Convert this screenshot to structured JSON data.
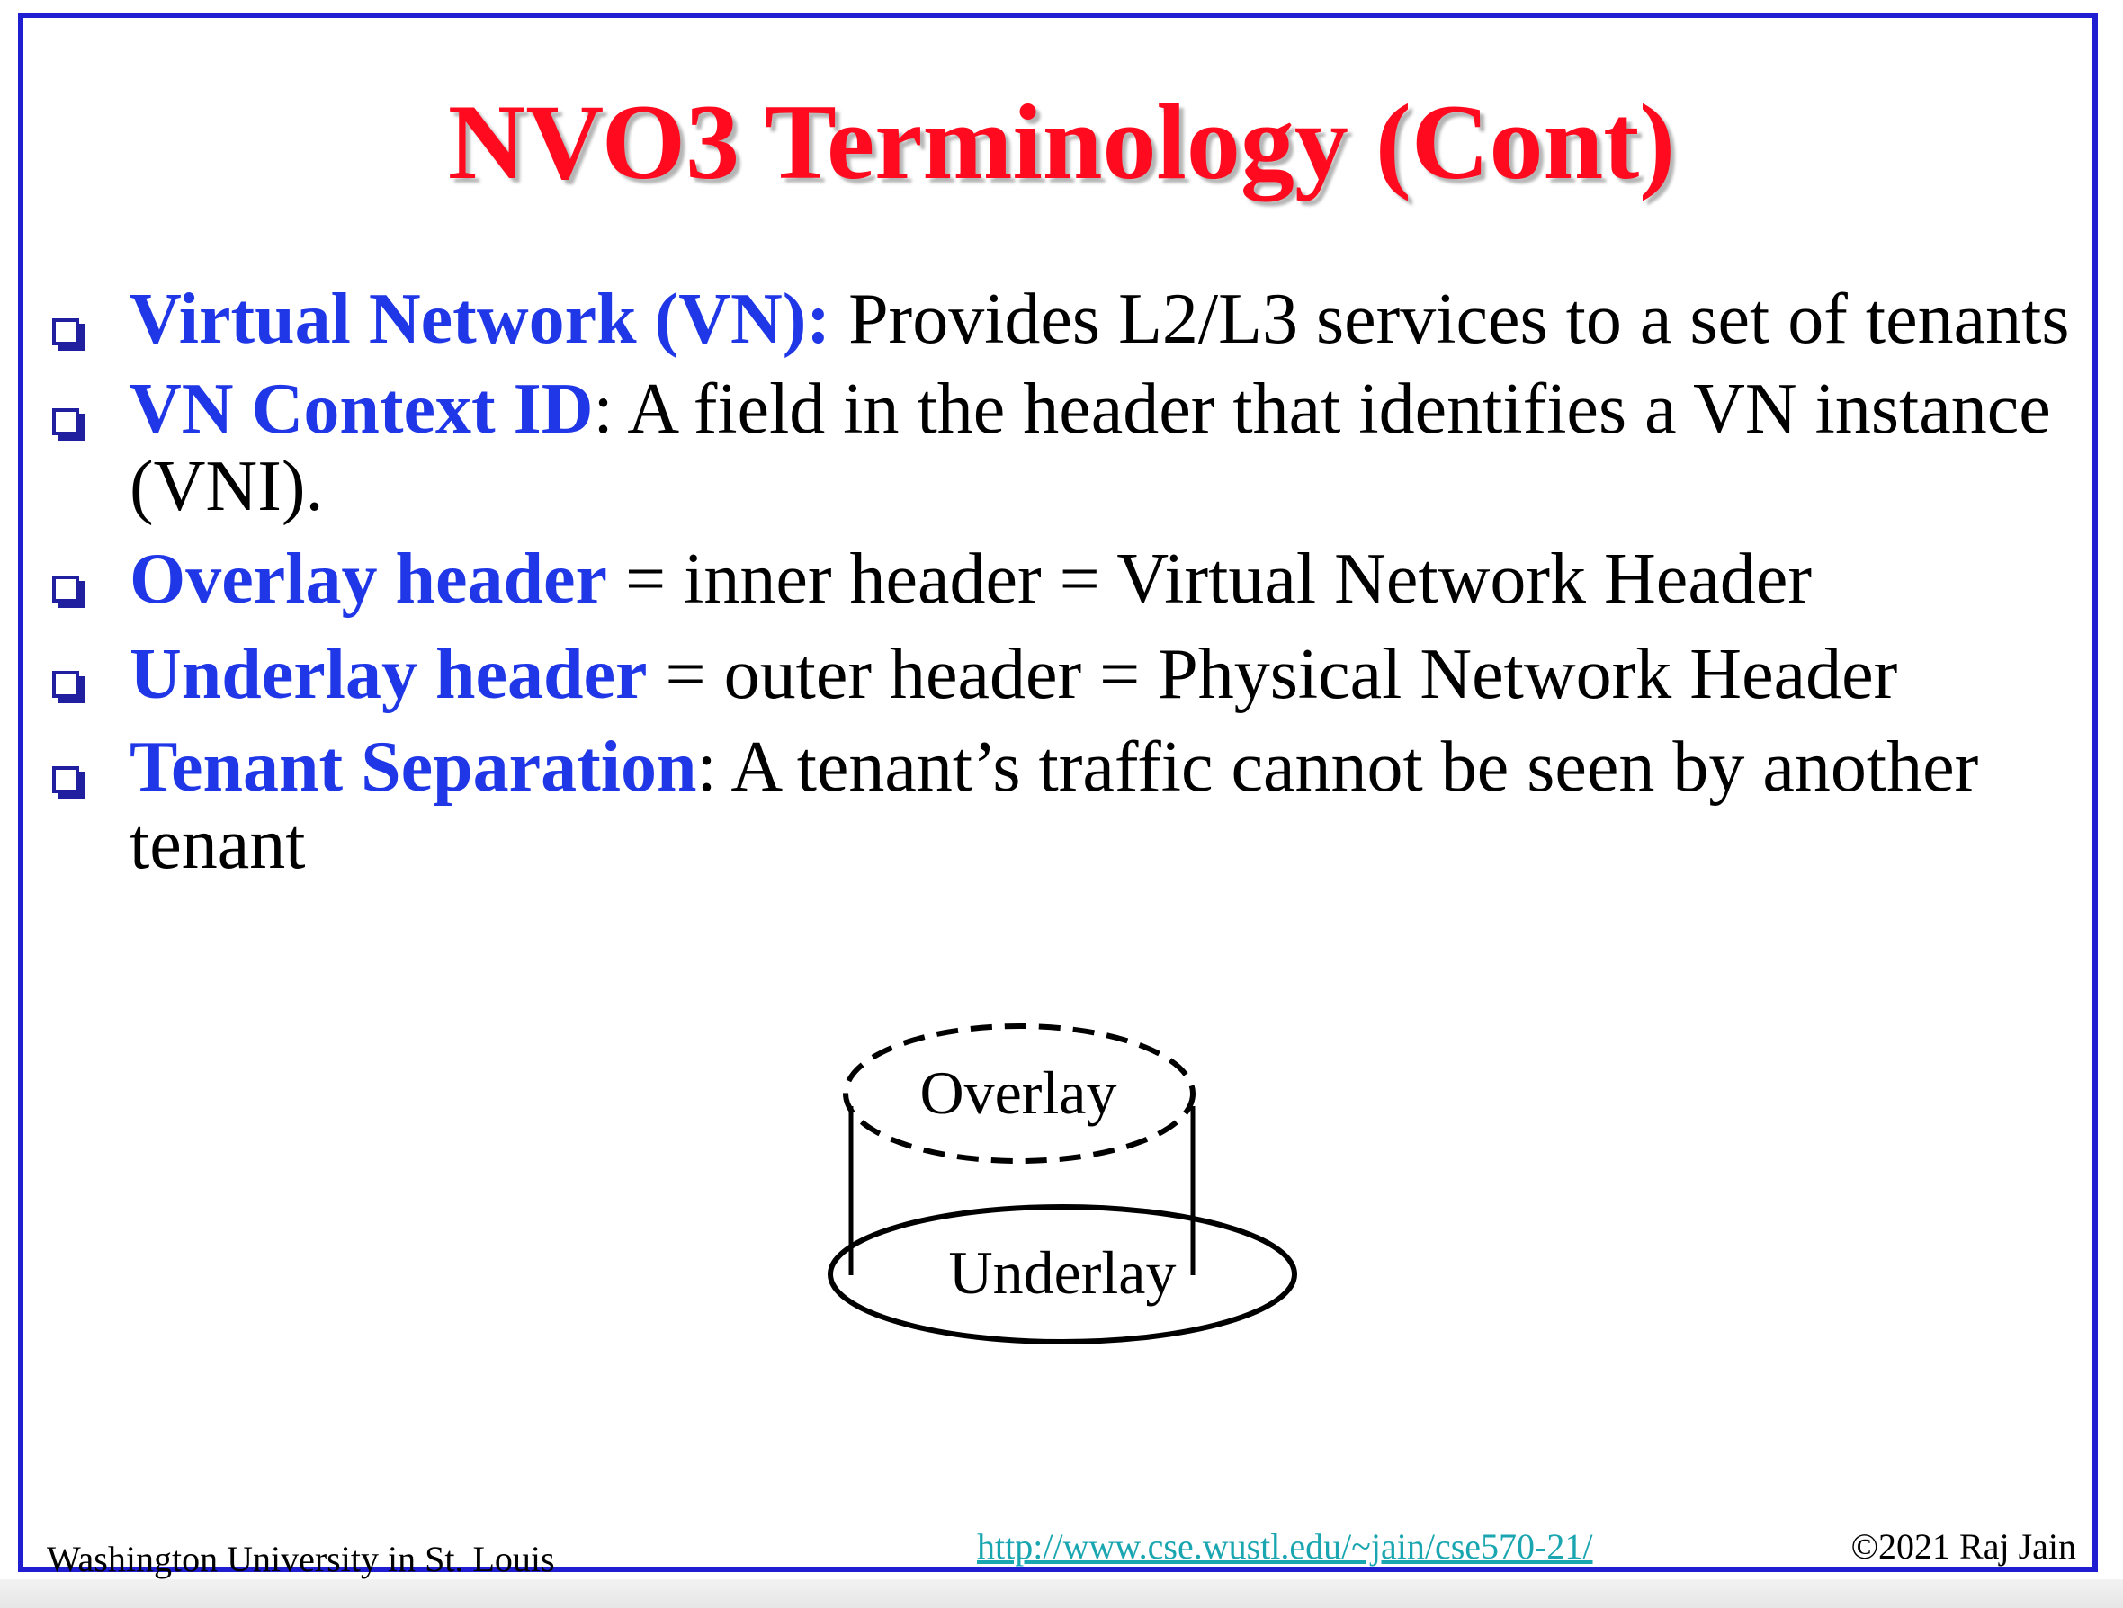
{
  "slide": {
    "title": "NVO3 Terminology (Cont)",
    "bullets": [
      {
        "term": "Virtual Network (VN):",
        "text": " Provides L2/L3 services to a set of tenants"
      },
      {
        "term": "VN Context ID",
        "text": ": A field in the header that identifies a VN instance (VNI)."
      },
      {
        "term": "Overlay header",
        "text": " = inner header = Virtual Network Header"
      },
      {
        "term": "Underlay header",
        "text": " = outer header = Physical Network Header"
      },
      {
        "term": "Tenant Separation",
        "text": ": A tenant’s traffic cannot be seen by another tenant"
      }
    ],
    "diagram": {
      "top_label": "Overlay",
      "bottom_label": "Underlay"
    }
  },
  "footer": {
    "institution": "Washington University in St. Louis",
    "url": "http://www.cse.wustl.edu/~jain/cse570-21/",
    "copyright": "©2021 Raj Jain"
  },
  "colors": {
    "title": "#ff0a1e",
    "term": "#1f37e6",
    "frame": "#1f1fd1",
    "link": "#1aa6b0"
  }
}
